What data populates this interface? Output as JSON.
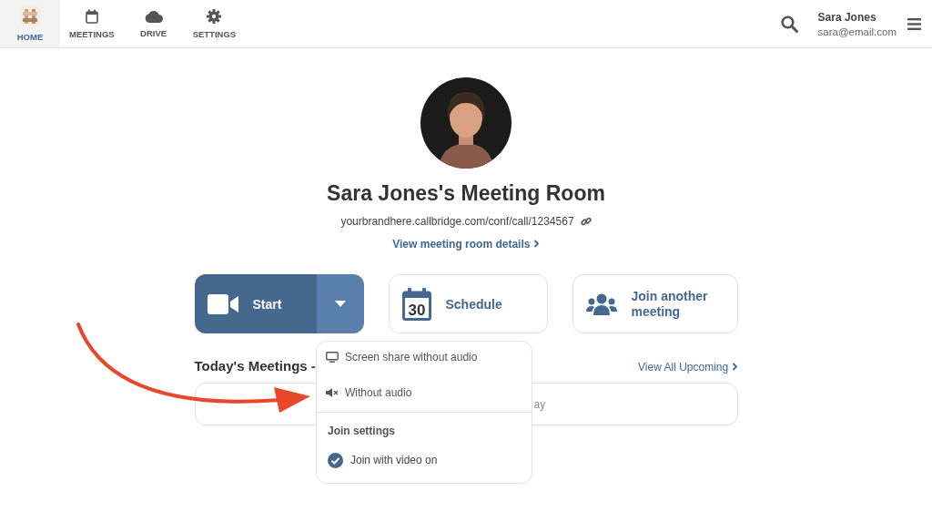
{
  "nav": {
    "tabs": [
      {
        "label": "HOME",
        "kind": "logo",
        "selected": true
      },
      {
        "label": "MEETINGS",
        "kind": "calendar",
        "selected": false
      },
      {
        "label": "DRIVE",
        "kind": "cloud",
        "selected": false
      },
      {
        "label": "SETTINGS",
        "kind": "gear",
        "selected": false
      }
    ],
    "user": {
      "name": "Sara Jones",
      "email": "sara@email.com"
    }
  },
  "room": {
    "title": "Sara Jones's Meeting Room",
    "url": "yourbrandhere.callbridge.com/conf/call/1234567",
    "details_link": "View meeting room details"
  },
  "actions": {
    "start": {
      "label": "Start"
    },
    "schedule": {
      "label": "Schedule",
      "day": "30"
    },
    "join": {
      "label": "Join another meeting"
    }
  },
  "todays_meetings": {
    "heading": "Today's Meetings -",
    "view_all": "View All Upcoming",
    "card_text": "ay"
  },
  "start_menu": {
    "items": [
      {
        "kind": "screen",
        "label": "Screen share without audio"
      },
      {
        "kind": "mute",
        "label": "Without audio"
      }
    ],
    "settings_heading": "Join settings",
    "settings": [
      {
        "label": "Join with video on",
        "checked": true
      }
    ]
  }
}
